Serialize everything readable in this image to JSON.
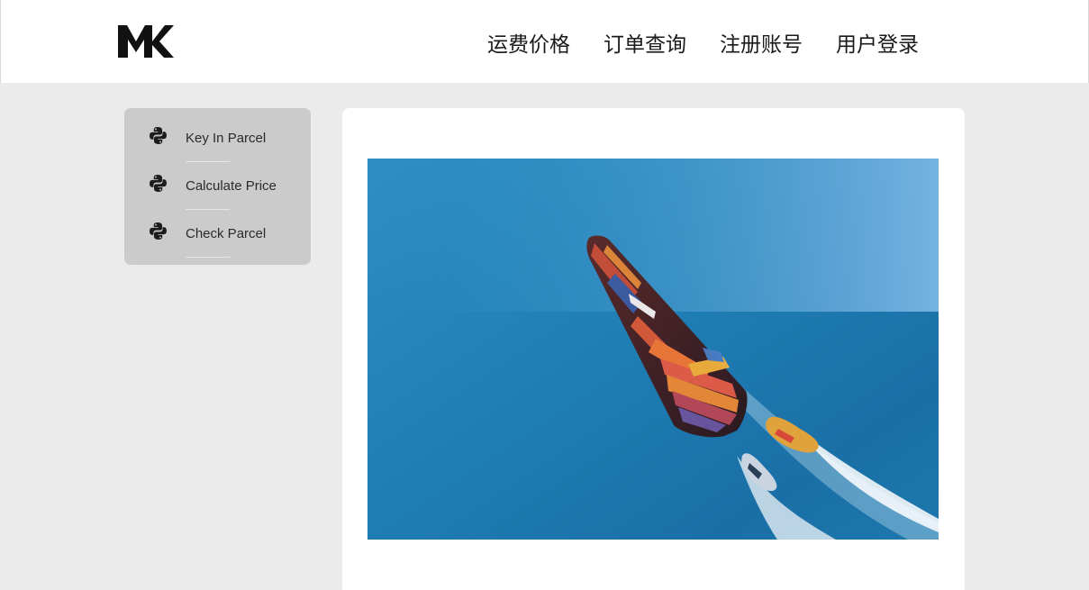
{
  "header": {
    "logo_text": "MK",
    "nav": [
      {
        "label": "运费价格"
      },
      {
        "label": "订单查询"
      },
      {
        "label": "注册账号"
      },
      {
        "label": "用户登录"
      }
    ]
  },
  "sidebar": {
    "items": [
      {
        "label": "Key In Parcel",
        "icon": "python-icon"
      },
      {
        "label": "Calculate Price",
        "icon": "python-icon"
      },
      {
        "label": "Check Parcel",
        "icon": "python-icon"
      }
    ]
  },
  "main": {
    "image": "aerial-container-ship-with-tugboats"
  },
  "colors": {
    "page_bg": "#ebebeb",
    "header_bg": "#ffffff",
    "sidebar_bg": "#cbcbcb",
    "card_bg": "#ffffff",
    "sea": "#1a7bb0"
  }
}
